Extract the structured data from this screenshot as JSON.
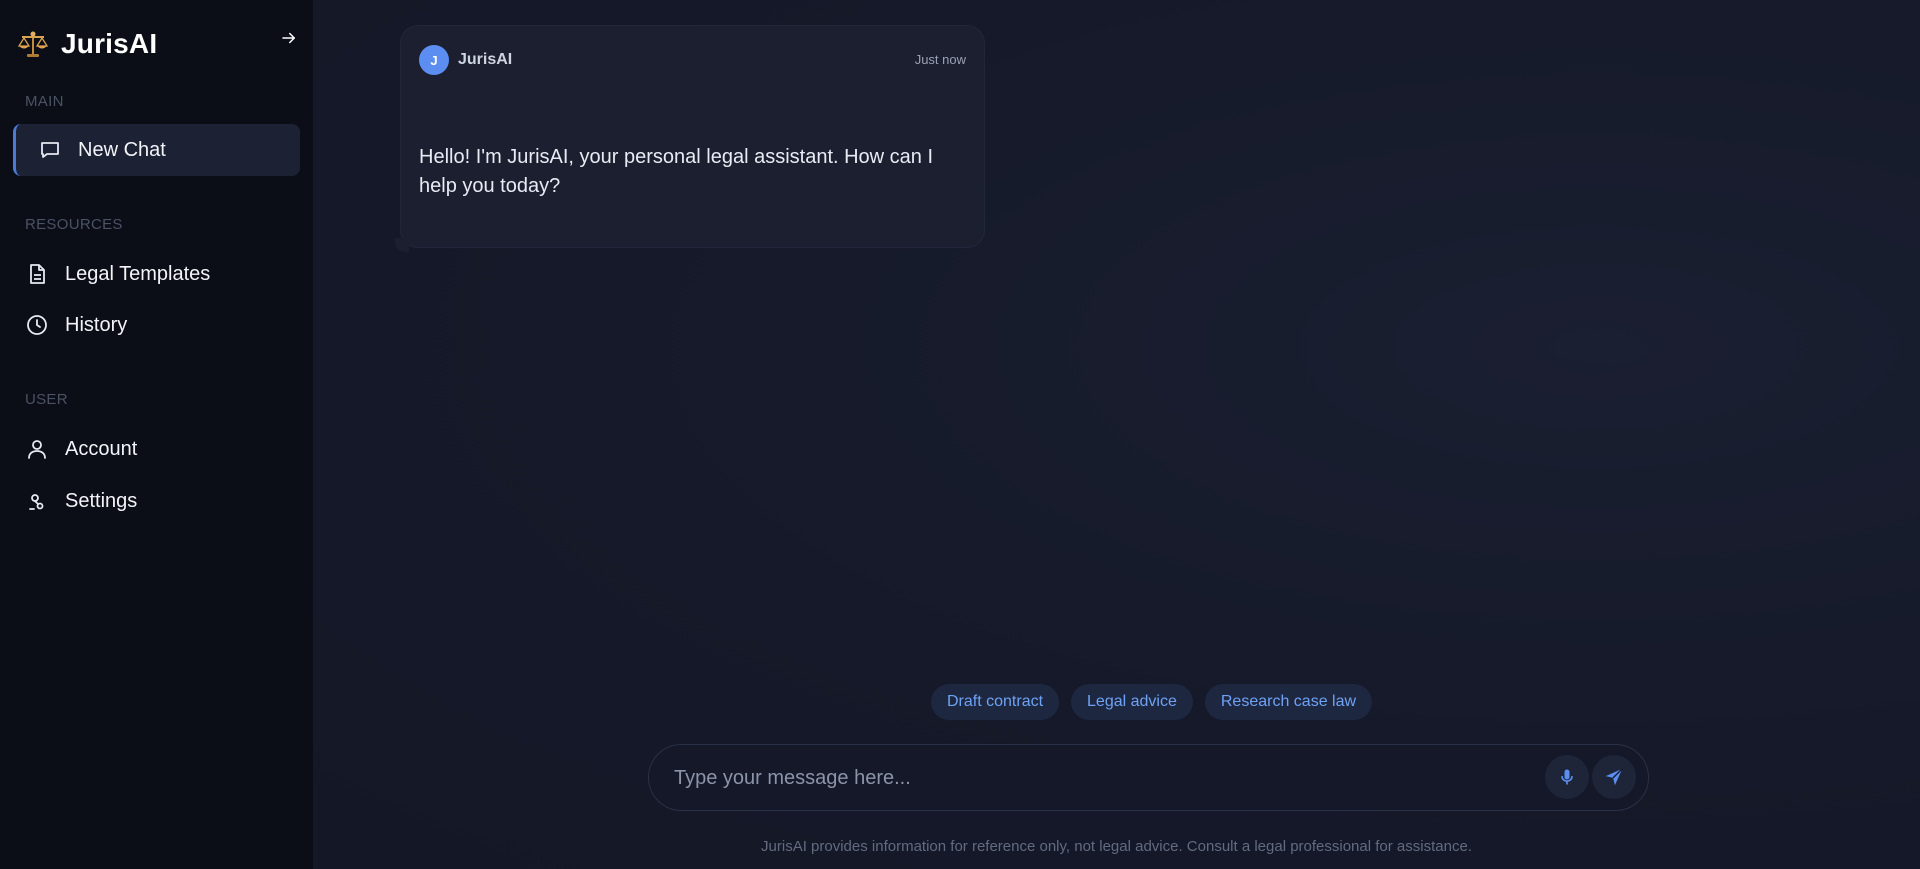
{
  "sidebar": {
    "brand": "JurisAI",
    "sections": {
      "main": "MAIN",
      "resources": "RESOURCES",
      "user": "USER"
    },
    "items": {
      "new_chat": "New Chat",
      "legal_templates": "Legal Templates",
      "history": "History",
      "account": "Account",
      "settings": "Settings"
    }
  },
  "chat": {
    "messages": [
      {
        "avatar_initial": "J",
        "sender": "JurisAI",
        "time": "Just now",
        "text": "Hello! I'm JurisAI, your personal legal assistant. How can I help you today?"
      }
    ],
    "suggestions": [
      "Draft contract",
      "Legal advice",
      "Research case law"
    ],
    "input": {
      "placeholder": "Type your message here...",
      "value": ""
    },
    "disclaimer": "JurisAI provides information for reference only, not legal advice. Consult a legal professional for assistance."
  },
  "icons": {
    "logo": "balance-scale-icon",
    "collapse": "arrow-right-icon",
    "new_chat": "chat-bubble-icon",
    "templates": "document-icon",
    "history": "clock-icon",
    "account": "user-icon",
    "settings": "settings-icon",
    "mic": "microphone-icon",
    "send": "send-icon"
  },
  "colors": {
    "accent": "#5b8ef0",
    "sidebar_bg": "#0b0d17",
    "main_bg": "#151929",
    "chip_text": "#6ea2f5"
  }
}
